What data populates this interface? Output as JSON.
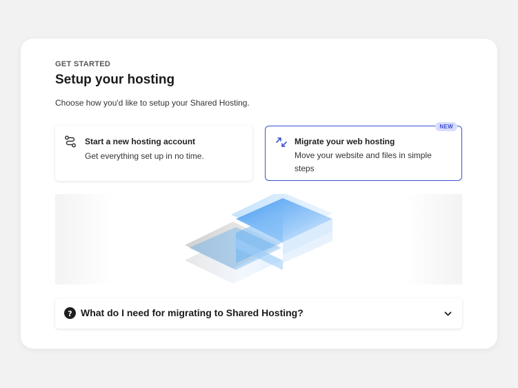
{
  "header": {
    "eyebrow": "GET STARTED",
    "title": "Setup your hosting",
    "subtitle": "Choose how you'd like to setup your Shared Hosting."
  },
  "options": [
    {
      "icon": "route-icon",
      "title": "Start a new hosting account",
      "description": "Get everything set up in no time.",
      "selected": false
    },
    {
      "icon": "migrate-arrows-icon",
      "title": "Migrate your web hosting",
      "description": "Move your website and files in simple steps",
      "selected": true,
      "badge": "NEW"
    }
  ],
  "faq": {
    "icon": "question-circle-icon",
    "question": "What do I need for migrating to Shared Hosting?",
    "toggle_icon": "chevron-down-icon"
  },
  "colors": {
    "accent": "#3a4fd1",
    "badge_bg": "#d9dcfb",
    "hero_blue": "#4aa3f2"
  }
}
